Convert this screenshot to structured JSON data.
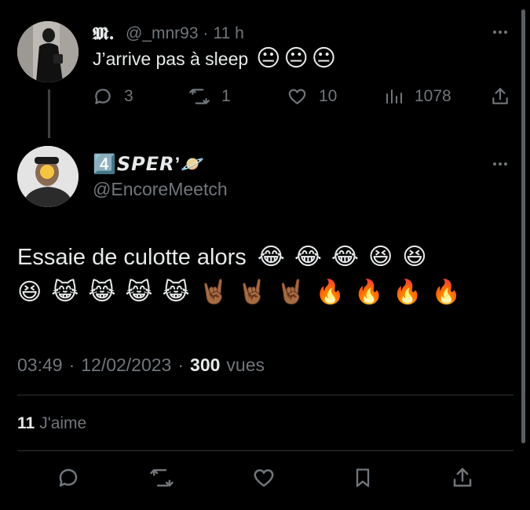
{
  "reply_tweet": {
    "display_name": "𝕸.",
    "handle": "@_mnr93",
    "separator": "·",
    "time": "11 h",
    "text": "J’arrive pas à sleep",
    "emojis": [
      "😐",
      "😐",
      "😐"
    ],
    "replies": "3",
    "retweets": "1",
    "likes": "10",
    "views": "1078"
  },
  "main_tweet": {
    "display_name": "4️⃣𝙎𝙋𝙀𝙍’🪐",
    "handle": "@EncoreMeetch",
    "text": "Essaie de culotte alors",
    "emojis_line1": [
      "😂",
      "😂",
      "😂",
      "😆",
      "😆"
    ],
    "emojis_line2": [
      "😆",
      "😹",
      "😹",
      "😹",
      "😹",
      "🤘🏾",
      "🤘🏾",
      "🤘🏾",
      "🔥",
      "🔥",
      "🔥",
      "🔥"
    ],
    "time": "03:49",
    "sep": "·",
    "date": "12/02/2023",
    "views_count": "300",
    "views_label": "vues",
    "likes_count": "11",
    "likes_label": "J'aime"
  },
  "icons": [
    "reply-icon",
    "retweet-icon",
    "like-icon",
    "views-icon",
    "share-icon",
    "bookmark-icon",
    "more-icon"
  ],
  "colors": {
    "background": "#000000",
    "text": "#e7e9ea",
    "muted": "#71767b",
    "divider": "#2f3336"
  }
}
